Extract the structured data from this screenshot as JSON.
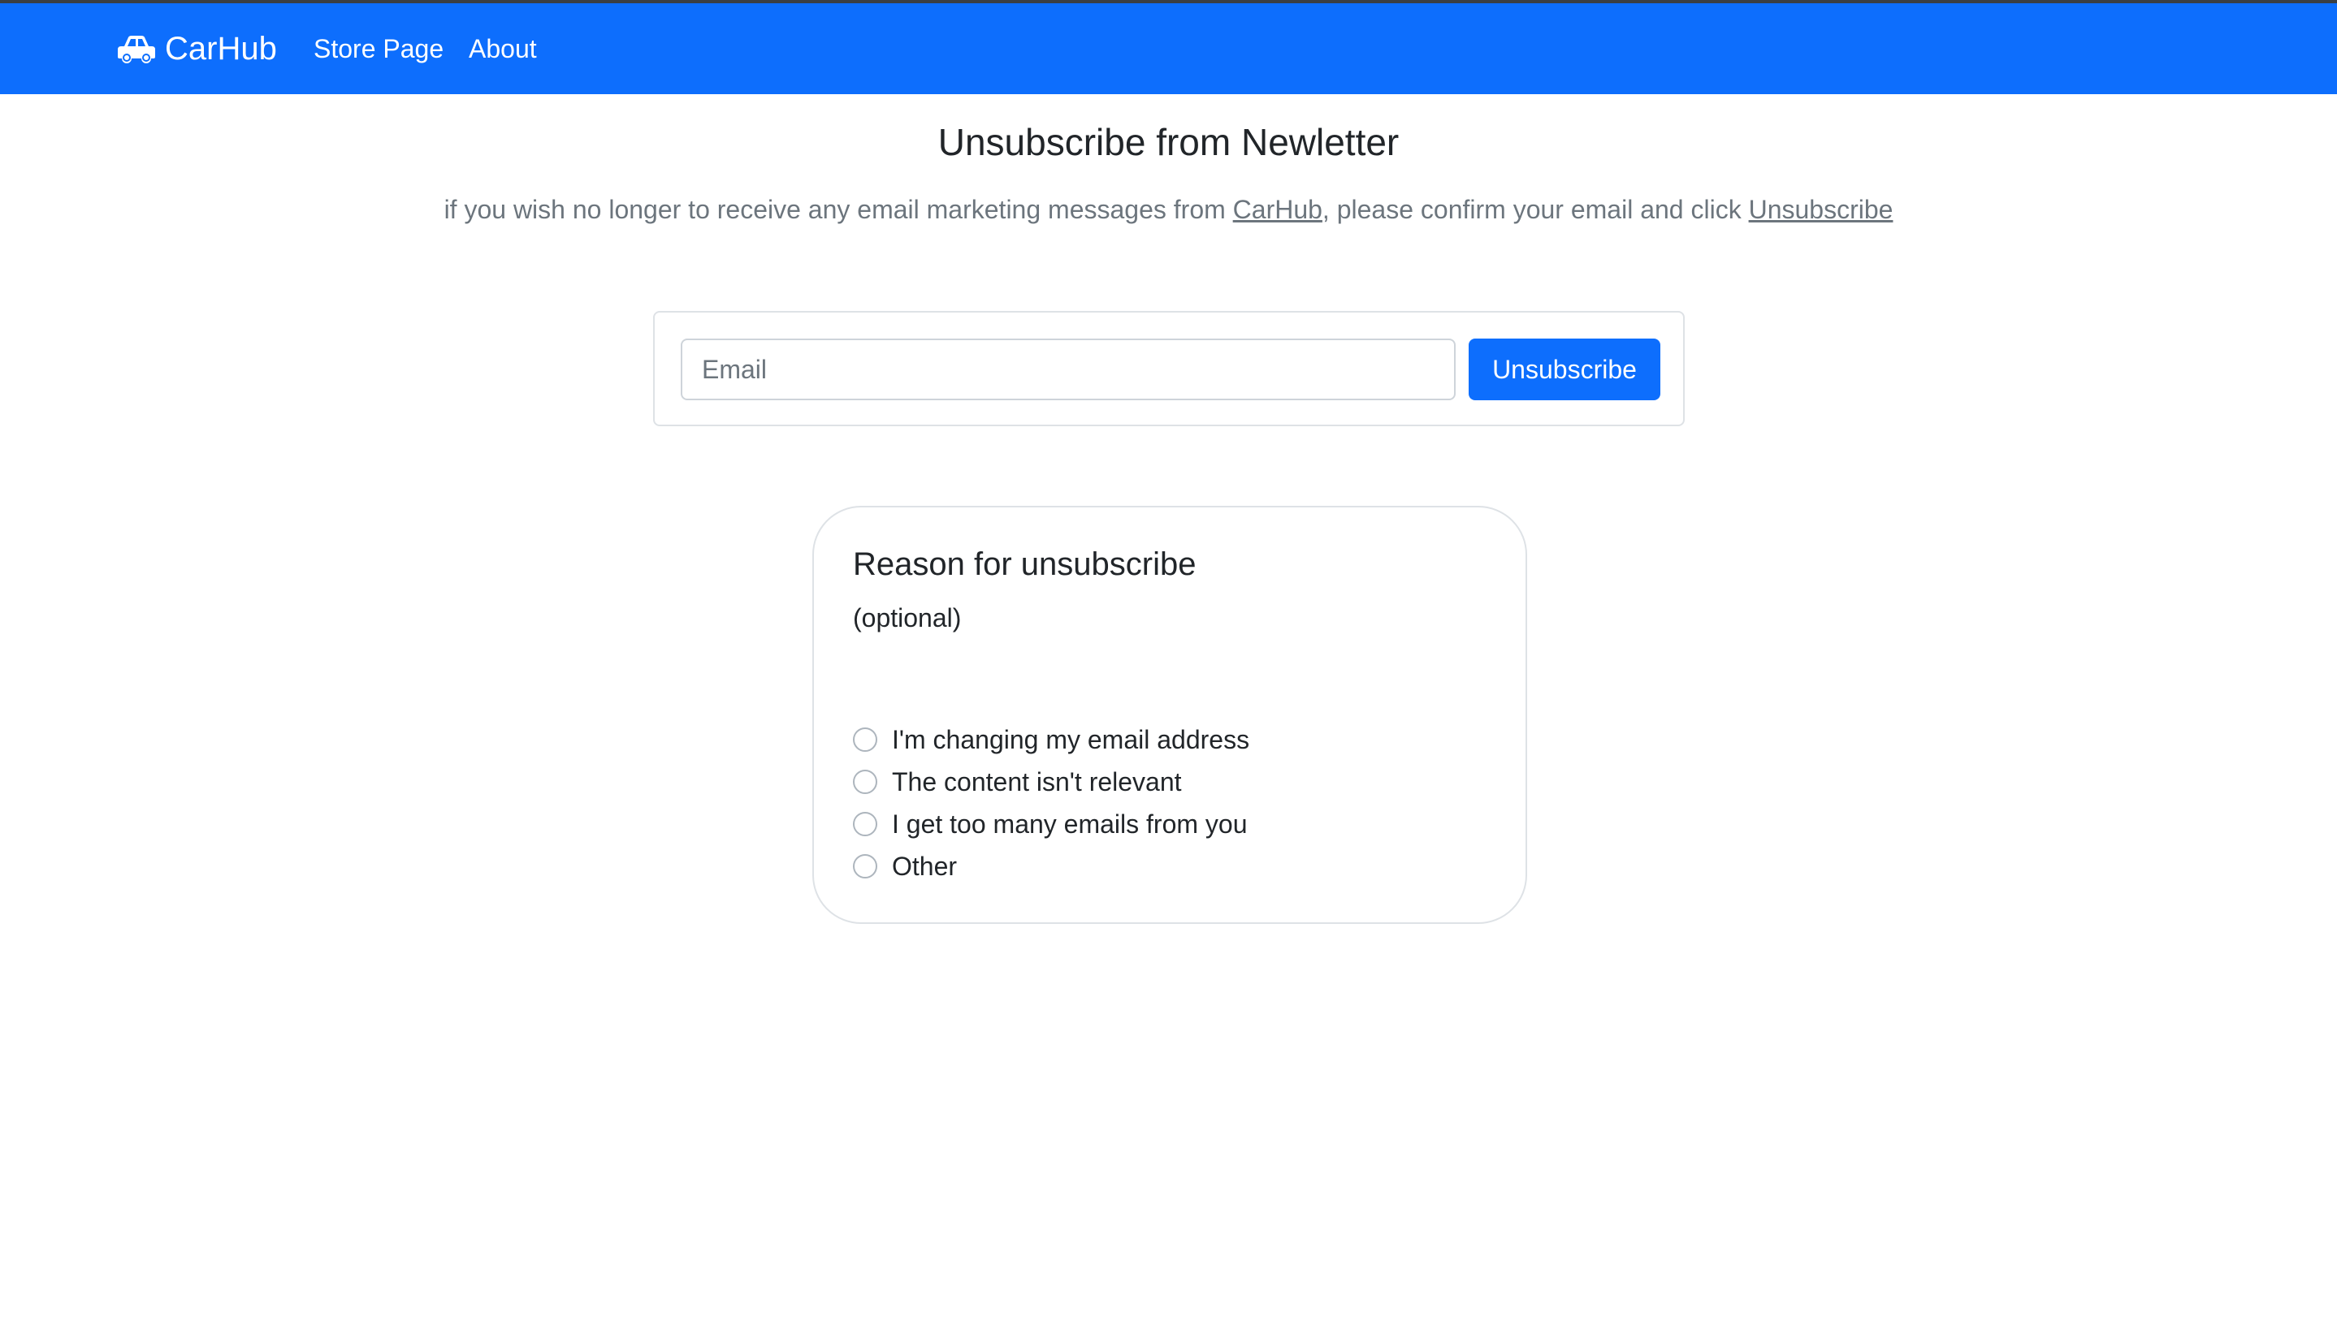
{
  "navbar": {
    "brand": "CarHub",
    "brand_icon": "car-icon",
    "links": [
      "Store Page",
      "About"
    ]
  },
  "page": {
    "title": "Unsubscribe from Newletter",
    "intro_prefix": "if you wish no longer to receive any email marketing messages from ",
    "intro_link_brand": "CarHub",
    "intro_middle": ", please confirm your email and click ",
    "intro_link_action": "Unsubscribe"
  },
  "form": {
    "email_placeholder": "Email",
    "email_value": "",
    "submit_label": "Unsubscribe"
  },
  "reason": {
    "title": "Reason for unsubscribe",
    "optional_note": "(optional)",
    "options": [
      "I'm changing my email address",
      "The content isn't relevant",
      "I get too many emails from you",
      "Other"
    ]
  },
  "colors": {
    "primary": "#0d6efd",
    "muted_text": "#6c757d",
    "border": "#dee2e6"
  }
}
